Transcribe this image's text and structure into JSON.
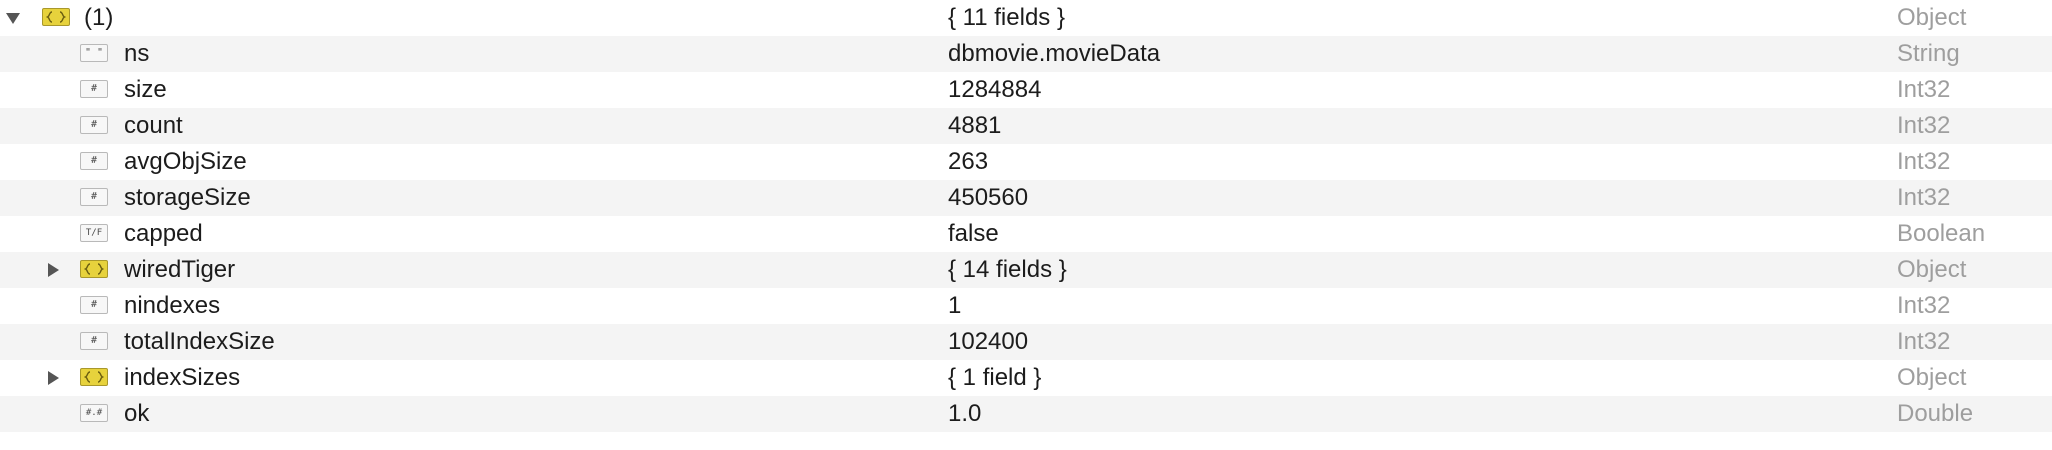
{
  "document": {
    "root": {
      "key": "(1)",
      "value": "{ 11 fields }",
      "type": "Object",
      "icon": "object-icon",
      "expanded": true
    },
    "fields": [
      {
        "key": "ns",
        "value": "dbmovie.movieData",
        "type": "String",
        "icon": "string-icon",
        "icon_glyph": "\" \""
      },
      {
        "key": "size",
        "value": "1284884",
        "type": "Int32",
        "icon": "number-icon",
        "icon_glyph": "#"
      },
      {
        "key": "count",
        "value": "4881",
        "type": "Int32",
        "icon": "number-icon",
        "icon_glyph": "#"
      },
      {
        "key": "avgObjSize",
        "value": "263",
        "type": "Int32",
        "icon": "number-icon",
        "icon_glyph": "#"
      },
      {
        "key": "storageSize",
        "value": "450560",
        "type": "Int32",
        "icon": "number-icon",
        "icon_glyph": "#"
      },
      {
        "key": "capped",
        "value": "false",
        "type": "Boolean",
        "icon": "boolean-icon",
        "icon_glyph": "T/F"
      },
      {
        "key": "wiredTiger",
        "value": "{ 14 fields }",
        "type": "Object",
        "icon": "object-icon",
        "expanded": false
      },
      {
        "key": "nindexes",
        "value": "1",
        "type": "Int32",
        "icon": "number-icon",
        "icon_glyph": "#"
      },
      {
        "key": "totalIndexSize",
        "value": "102400",
        "type": "Int32",
        "icon": "number-icon",
        "icon_glyph": "#"
      },
      {
        "key": "indexSizes",
        "value": "{ 1 field }",
        "type": "Object",
        "icon": "object-icon",
        "expanded": false
      },
      {
        "key": "ok",
        "value": "1.0",
        "type": "Double",
        "icon": "double-icon",
        "icon_glyph": "#.#"
      }
    ]
  },
  "colors": {
    "object_icon": "#e7d23c",
    "type_text": "#9e9e9e",
    "alt_row": "#f4f4f4"
  }
}
